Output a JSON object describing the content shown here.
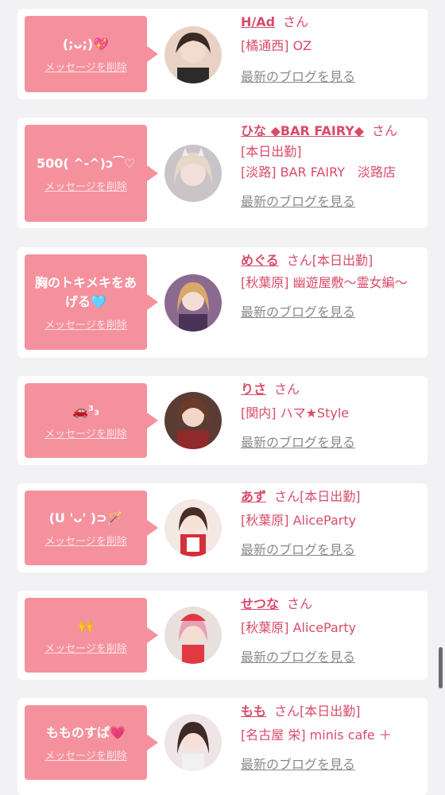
{
  "delete_label": "メッセージを削除",
  "blog_label": "最新のブログを見る",
  "san_label": "さん",
  "cards": [
    {
      "message": "(;ᴗ;)💖",
      "name": "H/Ad",
      "tag": "",
      "shop": "[橘通西] OZ"
    },
    {
      "message": "500( ^-^)ɔ⁀♡",
      "name": "ひな ◆BAR FAIRY◆",
      "tag": "",
      "status": "[本日出勤]",
      "shop": "[淡路] BAR FAIRY　淡路店"
    },
    {
      "message": "胸のトキメキをあげる🩵",
      "name": "めぐる",
      "tag": "[本日出勤]",
      "shop": "[秋葉原] 幽遊屋敷〜霊女編〜"
    },
    {
      "message": "🚗³₃",
      "name": "りさ",
      "tag": "",
      "shop": "[関内] ハマ★Style"
    },
    {
      "message": "(U 'ᴗ' )⊃🪄",
      "name": "あず",
      "tag": "[本日出勤]",
      "shop": "[秋葉原] AliceParty"
    },
    {
      "message": "🙌",
      "name": "せつな",
      "tag": "",
      "shop": "[秋葉原] AliceParty"
    },
    {
      "message": "もものすぱ💗",
      "name": "もも",
      "tag": "[本日出勤]",
      "shop": "[名古屋 栄] minis cafe ＋"
    }
  ],
  "colors": {
    "accent": "#d94b6a",
    "bubble": "#f5919d",
    "background": "#f2f2f4"
  }
}
